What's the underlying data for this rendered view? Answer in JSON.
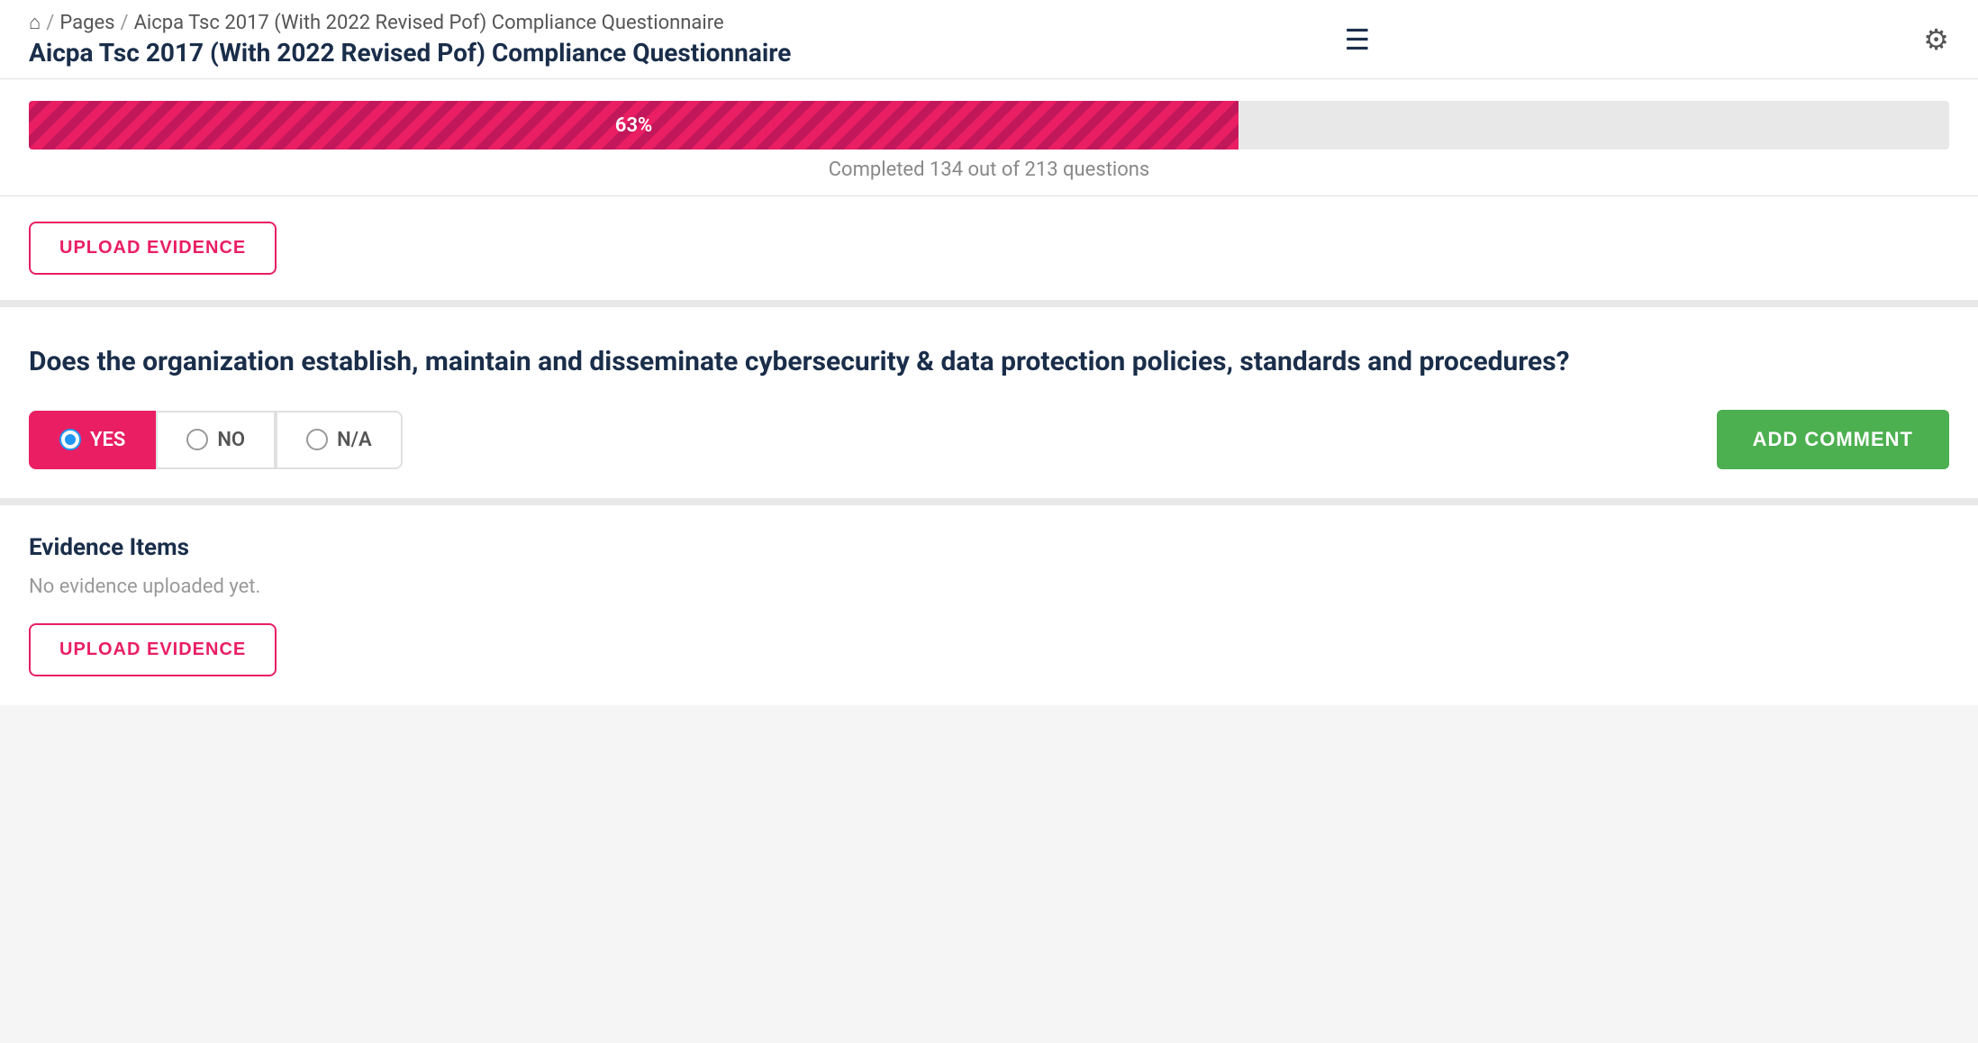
{
  "breadcrumb": {
    "home_icon": "⌂",
    "separator": "/",
    "pages_label": "Pages",
    "current_page": "Aicpa Tsc 2017 (With 2022 Revised Pof) Compliance Questionnaire"
  },
  "page_title": "Aicpa Tsc 2017 (With 2022 Revised Pof) Compliance Questionnaire",
  "header": {
    "hamburger_icon": "☰",
    "gear_icon": "⚙"
  },
  "progress": {
    "percent": 63,
    "percent_label": "63%",
    "completed": 134,
    "total": 213,
    "status_text": "Completed 134 out of 213 questions"
  },
  "upload_evidence_top": {
    "button_label": "UPLOAD EVIDENCE"
  },
  "question": {
    "text": "Does the organization establish, maintain and disseminate cybersecurity & data protection policies, standards and procedures?",
    "options": [
      {
        "id": "yes",
        "label": "YES",
        "selected": true
      },
      {
        "id": "no",
        "label": "NO",
        "selected": false
      },
      {
        "id": "na",
        "label": "N/A",
        "selected": false
      }
    ],
    "add_comment_label": "ADD COMMENT"
  },
  "evidence": {
    "title": "Evidence Items",
    "empty_message": "No evidence uploaded yet.",
    "upload_button_label": "UPLOAD EVIDENCE"
  }
}
